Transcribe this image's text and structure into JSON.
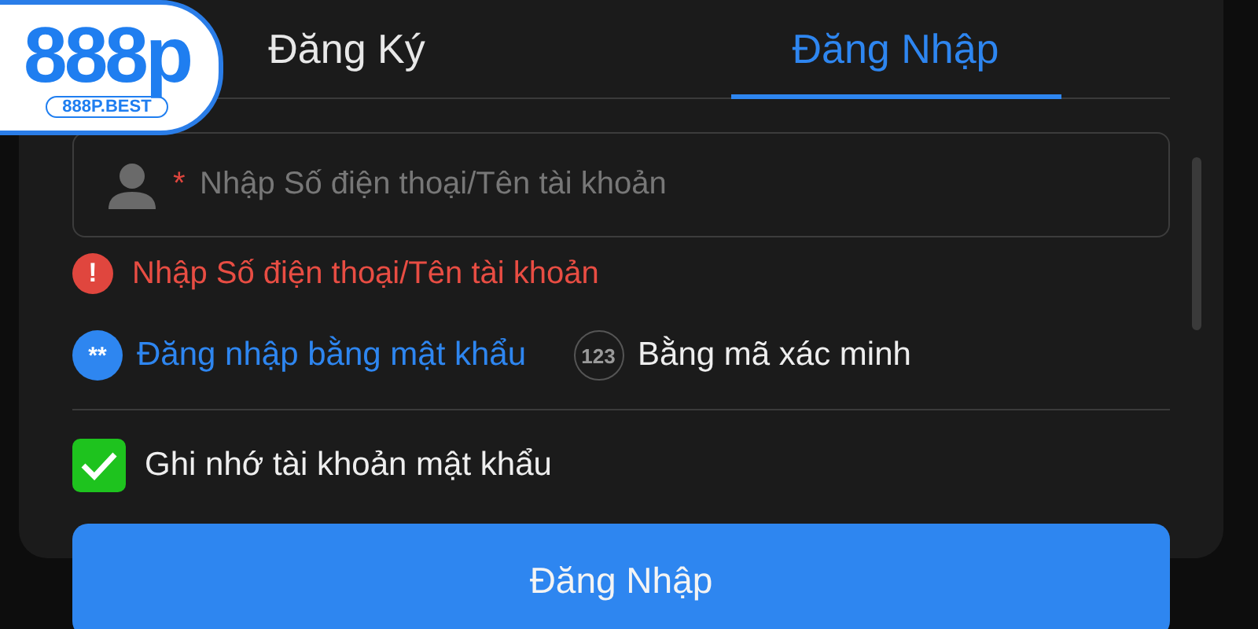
{
  "logo": {
    "mark": "888p",
    "domain": "888P.BEST"
  },
  "tabs": [
    {
      "label": "Đăng Ký",
      "selected": false
    },
    {
      "label": "Đăng Nhập",
      "selected": true
    }
  ],
  "account_field": {
    "required_mark": "*",
    "placeholder": "Nhập Số điện thoại/Tên tài khoản"
  },
  "error": {
    "icon": "!",
    "message": "Nhập Số điện thoại/Tên tài khoản"
  },
  "login_methods": [
    {
      "icon": "**",
      "label": "Đăng nhập bằng mật khẩu",
      "selected": true
    },
    {
      "icon": "123",
      "label": "Bằng mã xác minh",
      "selected": false
    }
  ],
  "remember": {
    "label": "Ghi nhớ tài khoản mật khẩu",
    "checked": true
  },
  "submit": "Đăng Nhập"
}
